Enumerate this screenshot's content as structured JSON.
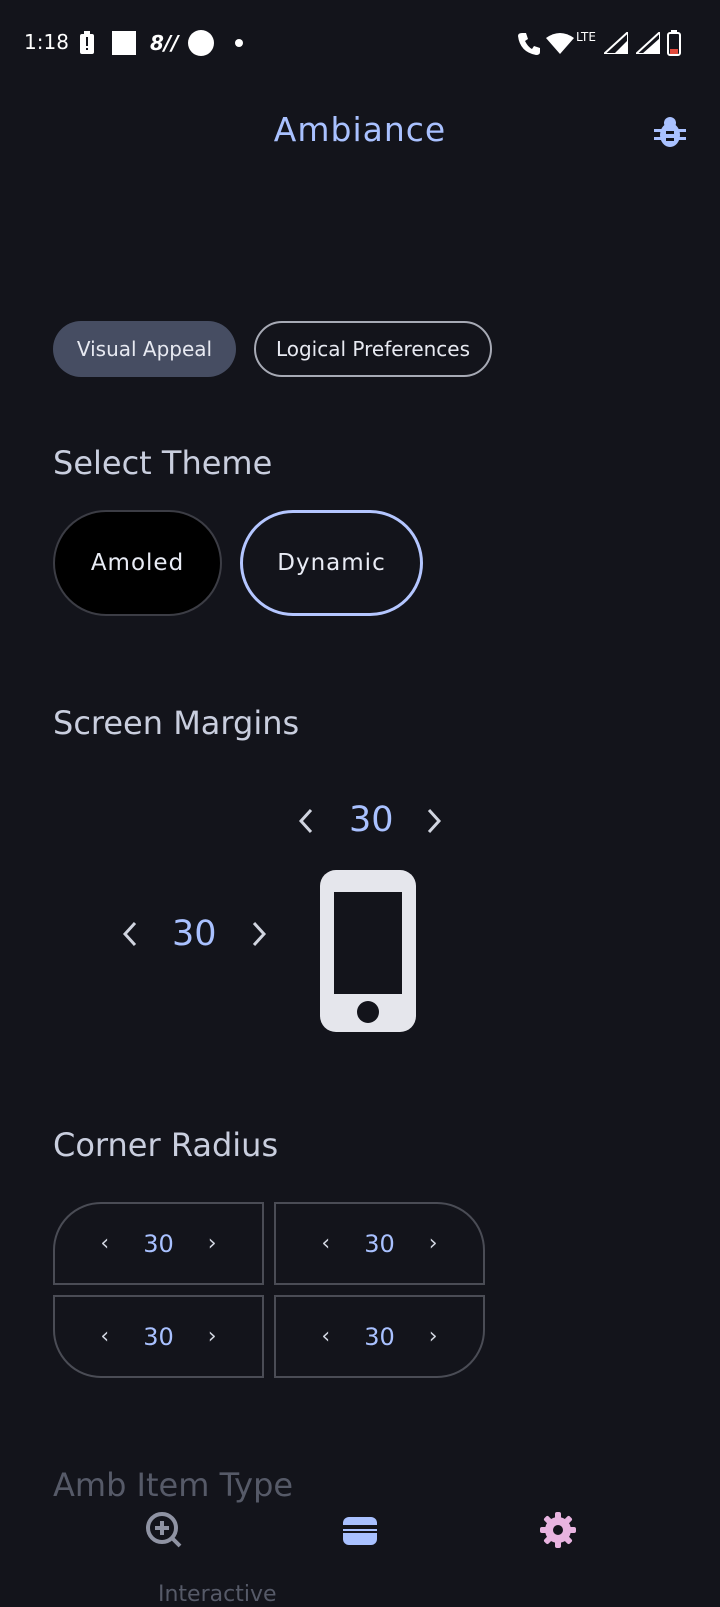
{
  "status_bar": {
    "time": "1:18",
    "network": "LTE"
  },
  "app_bar": {
    "title": "Ambiance",
    "debug_icon": "bug-icon"
  },
  "tabs": [
    {
      "label": "Visual Appeal",
      "active": true
    },
    {
      "label": "Logical Preferences",
      "active": false
    }
  ],
  "theme": {
    "title": "Select Theme",
    "options": [
      {
        "label": "Amoled",
        "selected": false
      },
      {
        "label": "Dynamic",
        "selected": true
      }
    ]
  },
  "margins": {
    "title": "Screen Margins",
    "vertical": "30",
    "horizontal": "30"
  },
  "corner_radius": {
    "title": "Corner Radius",
    "top_left": "30",
    "top_right": "30",
    "bottom_left": "30",
    "bottom_right": "30"
  },
  "amb_item": {
    "title": "Amb Item Type",
    "partial_label": "Interactive"
  },
  "colors": {
    "accent": "#a9c1ff",
    "background": "#13141b",
    "settings_icon": "#e8b4e0"
  },
  "bottom_nav": [
    {
      "icon": "add-circle-icon",
      "active": false
    },
    {
      "icon": "wallet-icon",
      "active": true
    },
    {
      "icon": "settings-icon",
      "active": false
    }
  ]
}
